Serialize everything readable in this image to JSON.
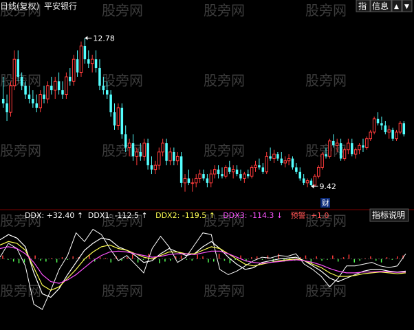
{
  "header": {
    "title": "日线(复权)",
    "stock_name": "平安银行",
    "buttons": [
      "指",
      "信息"
    ]
  },
  "price_panel": {
    "high_label": "12.78",
    "low_label": "9.42",
    "event_marker": "财"
  },
  "indicator_panel": {
    "legend": [
      {
        "label": "DDX:",
        "value": "+32.40",
        "arrow": "↑",
        "color": "#ffffff"
      },
      {
        "label": "DDX1:",
        "value": "-112.5",
        "arrow": "↑",
        "color": "#ffffff"
      },
      {
        "label": "DDX2:",
        "value": "-119.5",
        "arrow": "↑",
        "color": "#ffff54"
      },
      {
        "label": "DDX3:",
        "value": "-114.3",
        "arrow": "↓",
        "color": "#ff54ff"
      },
      {
        "label": "预警:",
        "value": "+1.0",
        "arrow": "",
        "color": "#ff5454"
      }
    ],
    "help_button": "指标说明"
  },
  "watermark": "股旁网",
  "colors": {
    "up": "#ff3b3b",
    "down": "#54ffff",
    "ddx": "#ffffff",
    "ddx2": "#ffff54",
    "ddx3": "#ff54ff",
    "bar_up": "#ff3b3b",
    "bar_down": "#54ff54"
  },
  "chart_data": [
    {
      "type": "candlestick",
      "title": "",
      "ylim": [
        9.0,
        13.3
      ],
      "annotations": [
        {
          "text": "12.78",
          "value": 12.78,
          "index": 22
        },
        {
          "text": "9.42",
          "value": 9.42,
          "index": 83
        }
      ],
      "candles": [
        [
          11.4,
          11.9,
          11.2,
          11.3
        ],
        [
          11.3,
          11.5,
          10.9,
          11.1
        ],
        [
          11.1,
          11.8,
          11.0,
          11.7
        ],
        [
          11.7,
          12.5,
          11.6,
          12.3
        ],
        [
          12.3,
          12.5,
          11.8,
          11.9
        ],
        [
          11.9,
          12.0,
          11.6,
          11.7
        ],
        [
          11.7,
          11.8,
          11.4,
          11.5
        ],
        [
          11.5,
          11.7,
          11.3,
          11.4
        ],
        [
          11.4,
          11.6,
          11.2,
          11.3
        ],
        [
          11.3,
          11.5,
          11.1,
          11.2
        ],
        [
          11.2,
          11.6,
          11.1,
          11.5
        ],
        [
          11.5,
          11.7,
          11.3,
          11.4
        ],
        [
          11.4,
          11.8,
          11.3,
          11.7
        ],
        [
          11.7,
          11.9,
          11.5,
          11.6
        ],
        [
          11.6,
          11.9,
          11.4,
          11.8
        ],
        [
          11.8,
          12.0,
          11.5,
          11.6
        ],
        [
          11.6,
          11.8,
          11.4,
          11.5
        ],
        [
          11.5,
          12.0,
          11.4,
          11.9
        ],
        [
          11.9,
          12.1,
          11.7,
          11.8
        ],
        [
          11.8,
          12.4,
          11.7,
          12.3
        ],
        [
          12.3,
          12.5,
          11.9,
          12.0
        ],
        [
          12.0,
          12.7,
          11.9,
          12.6
        ],
        [
          12.6,
          12.78,
          12.2,
          12.3
        ],
        [
          12.3,
          12.5,
          12.1,
          12.2
        ],
        [
          12.2,
          12.4,
          12.0,
          12.3
        ],
        [
          12.3,
          12.5,
          12.0,
          12.1
        ],
        [
          12.1,
          12.3,
          11.6,
          11.7
        ],
        [
          11.7,
          11.9,
          11.5,
          11.6
        ],
        [
          11.6,
          11.8,
          11.4,
          11.5
        ],
        [
          11.5,
          11.6,
          11.0,
          11.1
        ],
        [
          11.1,
          11.3,
          10.7,
          10.8
        ],
        [
          10.8,
          11.3,
          10.7,
          11.2
        ],
        [
          11.2,
          11.3,
          10.5,
          10.6
        ],
        [
          10.6,
          10.8,
          10.2,
          10.3
        ],
        [
          10.3,
          10.5,
          10.1,
          10.4
        ],
        [
          10.4,
          10.6,
          10.0,
          10.1
        ],
        [
          10.1,
          10.3,
          9.9,
          10.2
        ],
        [
          10.2,
          10.4,
          10.0,
          10.1
        ],
        [
          10.1,
          10.5,
          10.0,
          10.4
        ],
        [
          10.4,
          10.5,
          9.8,
          9.9
        ],
        [
          9.9,
          10.1,
          9.7,
          9.8
        ],
        [
          9.8,
          10.0,
          9.7,
          9.9
        ],
        [
          9.9,
          10.3,
          9.8,
          10.2
        ],
        [
          10.2,
          10.5,
          10.1,
          10.4
        ],
        [
          10.4,
          10.5,
          9.9,
          10.0
        ],
        [
          10.0,
          10.3,
          9.9,
          10.2
        ],
        [
          10.2,
          10.3,
          9.9,
          10.0
        ],
        [
          10.0,
          10.2,
          9.9,
          10.1
        ],
        [
          10.1,
          10.2,
          9.4,
          9.5
        ],
        [
          9.5,
          9.7,
          9.3,
          9.6
        ],
        [
          9.6,
          9.8,
          9.45,
          9.5
        ],
        [
          9.5,
          9.6,
          9.3,
          9.5
        ],
        [
          9.5,
          9.7,
          9.4,
          9.6
        ],
        [
          9.6,
          9.8,
          9.5,
          9.7
        ],
        [
          9.7,
          9.8,
          9.55,
          9.6
        ],
        [
          9.6,
          9.7,
          9.4,
          9.5
        ],
        [
          9.5,
          9.8,
          9.4,
          9.7
        ],
        [
          9.7,
          9.9,
          9.6,
          9.8
        ],
        [
          9.8,
          9.9,
          9.6,
          9.7
        ],
        [
          9.7,
          9.85,
          9.6,
          9.65
        ],
        [
          9.65,
          9.9,
          9.6,
          9.85
        ],
        [
          9.85,
          10.0,
          9.7,
          9.75
        ],
        [
          9.75,
          9.9,
          9.6,
          9.8
        ],
        [
          9.8,
          9.9,
          9.65,
          9.7
        ],
        [
          9.7,
          9.8,
          9.55,
          9.6
        ],
        [
          9.6,
          9.75,
          9.5,
          9.7
        ],
        [
          9.7,
          9.8,
          9.6,
          9.65
        ],
        [
          9.65,
          9.9,
          9.6,
          9.85
        ],
        [
          9.85,
          10.0,
          9.75,
          9.9
        ],
        [
          9.9,
          10.05,
          9.8,
          9.85
        ],
        [
          9.85,
          9.95,
          9.7,
          9.75
        ],
        [
          9.75,
          10.2,
          9.7,
          10.1
        ],
        [
          10.1,
          10.3,
          10.0,
          10.05
        ],
        [
          10.05,
          10.25,
          9.95,
          10.15
        ],
        [
          10.15,
          10.2,
          10.0,
          10.05
        ],
        [
          10.05,
          10.2,
          9.9,
          9.95
        ],
        [
          9.95,
          10.1,
          9.85,
          10.0
        ],
        [
          10.0,
          10.15,
          9.9,
          10.05
        ],
        [
          10.05,
          10.1,
          9.8,
          9.85
        ],
        [
          9.85,
          9.95,
          9.7,
          9.75
        ],
        [
          9.75,
          9.85,
          9.55,
          9.6
        ],
        [
          9.6,
          9.7,
          9.45,
          9.5
        ],
        [
          9.5,
          9.6,
          9.4,
          9.55
        ],
        [
          9.55,
          9.6,
          9.42,
          9.45
        ],
        [
          9.45,
          9.7,
          9.42,
          9.65
        ],
        [
          9.65,
          9.9,
          9.6,
          9.85
        ],
        [
          9.85,
          10.2,
          9.8,
          10.15
        ],
        [
          10.15,
          10.3,
          10.05,
          10.1
        ],
        [
          10.1,
          10.5,
          10.05,
          10.45
        ],
        [
          10.45,
          10.6,
          10.3,
          10.35
        ],
        [
          10.35,
          10.5,
          10.2,
          10.4
        ],
        [
          10.4,
          10.5,
          10.0,
          10.05
        ],
        [
          10.05,
          10.3,
          10.0,
          10.25
        ],
        [
          10.25,
          10.5,
          10.15,
          10.4
        ],
        [
          10.4,
          10.5,
          10.1,
          10.15
        ],
        [
          10.15,
          10.3,
          10.05,
          10.25
        ],
        [
          10.25,
          10.4,
          10.15,
          10.35
        ],
        [
          10.35,
          10.5,
          10.2,
          10.3
        ],
        [
          10.3,
          10.55,
          10.25,
          10.5
        ],
        [
          10.5,
          10.7,
          10.45,
          10.65
        ],
        [
          10.65,
          11.0,
          10.6,
          10.95
        ],
        [
          10.95,
          11.1,
          10.8,
          10.85
        ],
        [
          10.85,
          11.0,
          10.7,
          10.8
        ],
        [
          10.8,
          10.9,
          10.6,
          10.65
        ],
        [
          10.65,
          10.8,
          10.5,
          10.7
        ],
        [
          10.7,
          10.75,
          10.45,
          10.5
        ],
        [
          10.5,
          10.7,
          10.45,
          10.65
        ],
        [
          10.65,
          10.9,
          10.6,
          10.85
        ],
        [
          10.85,
          10.9,
          10.55,
          10.6
        ]
      ]
    },
    {
      "type": "line",
      "title": "",
      "ylim": [
        -400,
        200
      ],
      "legend_position": "top-left",
      "series": [
        {
          "name": "DDX",
          "values": [
            10,
            90,
            60,
            -40,
            -260,
            -290,
            -180,
            -60,
            20,
            150,
            100,
            170,
            140,
            60,
            -10,
            20,
            -30,
            -80,
            60,
            130,
            70,
            -20,
            10,
            80,
            150,
            140,
            -60,
            -90,
            -70,
            -40,
            -10,
            10,
            5,
            20,
            15,
            30,
            -30,
            -60,
            -100,
            -160,
            -110,
            -40,
            -40,
            -30,
            -20,
            -40,
            -50,
            -40,
            30
          ]
        },
        {
          "name": "DDX1",
          "values": [
            110,
            140,
            120,
            70,
            -80,
            -200,
            -220,
            -170,
            -90,
            -20,
            50,
            90,
            120,
            110,
            70,
            50,
            20,
            -20,
            -10,
            30,
            60,
            40,
            20,
            30,
            70,
            100,
            60,
            10,
            -30,
            -60,
            -50,
            -20,
            -10,
            0,
            5,
            10,
            -10,
            -40,
            -70,
            -110,
            -130,
            -110,
            -90,
            -70,
            -60,
            -60,
            -70,
            -75,
            -70
          ]
        },
        {
          "name": "DDX2",
          "values": [
            80,
            100,
            90,
            50,
            -50,
            -150,
            -180,
            -160,
            -110,
            -60,
            0,
            40,
            70,
            80,
            60,
            50,
            30,
            10,
            0,
            20,
            40,
            40,
            30,
            30,
            50,
            70,
            60,
            30,
            0,
            -30,
            -40,
            -30,
            -20,
            -10,
            -5,
            0,
            -10,
            -30,
            -50,
            -80,
            -100,
            -100,
            -95,
            -85,
            -80,
            -75,
            -80,
            -85,
            -80
          ]
        },
        {
          "name": "DDX3",
          "values": [
            60,
            70,
            60,
            30,
            -20,
            -90,
            -130,
            -140,
            -120,
            -90,
            -50,
            -10,
            20,
            40,
            45,
            40,
            30,
            20,
            10,
            15,
            25,
            30,
            30,
            25,
            35,
            45,
            45,
            30,
            10,
            -10,
            -20,
            -25,
            -20,
            -15,
            -10,
            -5,
            -10,
            -20,
            -35,
            -55,
            -70,
            -80,
            -80,
            -75,
            -75,
            -72,
            -74,
            -77,
            -75
          ]
        },
        {
          "name": "预警",
          "values": [
            1,
            1,
            1,
            1,
            1,
            1,
            1,
            1,
            1,
            1,
            1,
            1,
            1,
            1,
            1,
            1,
            1,
            1,
            1,
            1,
            1,
            1,
            1,
            1,
            1,
            1,
            1,
            1,
            1,
            1,
            1,
            1,
            1,
            1,
            1,
            1,
            1,
            1,
            1,
            1,
            1,
            1,
            1,
            1,
            1,
            1,
            1,
            1,
            1
          ]
        }
      ],
      "bars": [
        20,
        -5,
        -15,
        -25,
        -20,
        15,
        20,
        -10,
        -15,
        5,
        -20,
        10,
        -5,
        15,
        10,
        -10,
        20,
        -15,
        10,
        5,
        -20,
        15,
        -10,
        10,
        25,
        -20,
        -5,
        30,
        10,
        -25,
        -15,
        -10,
        15,
        20,
        -5,
        -10,
        25,
        15,
        -20,
        -15,
        30,
        -10,
        -25,
        -5,
        20,
        -15,
        10,
        15,
        -5,
        20,
        -20,
        30,
        -15,
        5,
        -10,
        10,
        20,
        -25,
        15,
        -10,
        -5,
        20,
        -15,
        10,
        25,
        -20,
        -10,
        5,
        15,
        -10,
        -20,
        10,
        -5,
        15,
        20
      ]
    }
  ]
}
